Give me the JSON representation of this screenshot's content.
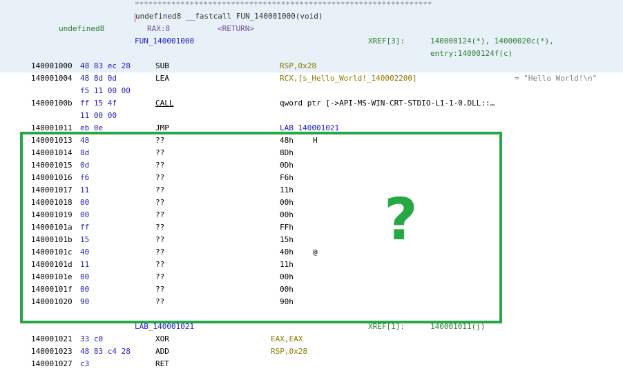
{
  "header": {
    "stars": "*****************************************************************",
    "signature": "undefined8 __fastcall FUN_140001000(void)",
    "ret_type": "undefined8",
    "ret_reg": "RAX:8",
    "ret_label": "<RETURN>",
    "func_label": "FUN_140001000",
    "xref_label": "XREF[3]:",
    "xref_line1": "140000124(*), 14000020c(*),",
    "xref_line2": "entry:14000124f(c)"
  },
  "instructions": [
    {
      "addr": "140001000",
      "bytes": "48 83 ec 28",
      "mn": "SUB",
      "ops": "RSP,0x28"
    },
    {
      "addr": "140001004",
      "bytes": "48 8d 0d",
      "mn": "LEA",
      "ops": "RCX,[s_Hello_World!_140002200]",
      "comment": "= \"Hello World!\\n\""
    },
    {
      "bytes": "f5 11 00 00"
    },
    {
      "addr": "14000100b",
      "bytes": "ff 15 4f",
      "mn": "CALL",
      "ops": "qword ptr [->API-MS-WIN-CRT-STDIO-L1-1-0.DLL::…"
    },
    {
      "bytes": "11 00 00"
    },
    {
      "addr": "140001011",
      "bytes": "eb 0e",
      "mn": "JMP",
      "ops": "LAB_140001021"
    }
  ],
  "data_rows": [
    {
      "addr": "140001013",
      "byte": "48",
      "mn": "??",
      "val": "48h",
      "ch": "H"
    },
    {
      "addr": "140001014",
      "byte": "8d",
      "mn": "??",
      "val": "8Dh",
      "ch": ""
    },
    {
      "addr": "140001015",
      "byte": "0d",
      "mn": "??",
      "val": "0Dh",
      "ch": ""
    },
    {
      "addr": "140001016",
      "byte": "f6",
      "mn": "??",
      "val": "F6h",
      "ch": ""
    },
    {
      "addr": "140001017",
      "byte": "11",
      "mn": "??",
      "val": "11h",
      "ch": ""
    },
    {
      "addr": "140001018",
      "byte": "00",
      "mn": "??",
      "val": "00h",
      "ch": ""
    },
    {
      "addr": "140001019",
      "byte": "00",
      "mn": "??",
      "val": "00h",
      "ch": ""
    },
    {
      "addr": "14000101a",
      "byte": "ff",
      "mn": "??",
      "val": "FFh",
      "ch": ""
    },
    {
      "addr": "14000101b",
      "byte": "15",
      "mn": "??",
      "val": "15h",
      "ch": ""
    },
    {
      "addr": "14000101c",
      "byte": "40",
      "mn": "??",
      "val": "40h",
      "ch": "@"
    },
    {
      "addr": "14000101d",
      "byte": "11",
      "mn": "??",
      "val": "11h",
      "ch": ""
    },
    {
      "addr": "14000101e",
      "byte": "00",
      "mn": "??",
      "val": "00h",
      "ch": ""
    },
    {
      "addr": "14000101f",
      "byte": "00",
      "mn": "??",
      "val": "00h",
      "ch": ""
    },
    {
      "addr": "140001020",
      "byte": "90",
      "mn": "??",
      "val": "90h",
      "ch": ""
    }
  ],
  "label2": {
    "name": "LAB_140001021",
    "xref_label": "XREF[1]:",
    "xref": "140001011(j)"
  },
  "tail": [
    {
      "addr": "140001021",
      "bytes": "33 c0",
      "mn": "XOR",
      "ops": "EAX,EAX"
    },
    {
      "addr": "140001023",
      "bytes": "48 83 c4 28",
      "mn": "ADD",
      "ops": "RSP,0x28"
    },
    {
      "addr": "140001027",
      "bytes": "c3",
      "mn": "RET",
      "ops": ""
    }
  ],
  "overlay": {
    "question_mark": "?",
    "box_color": "#27a846"
  }
}
